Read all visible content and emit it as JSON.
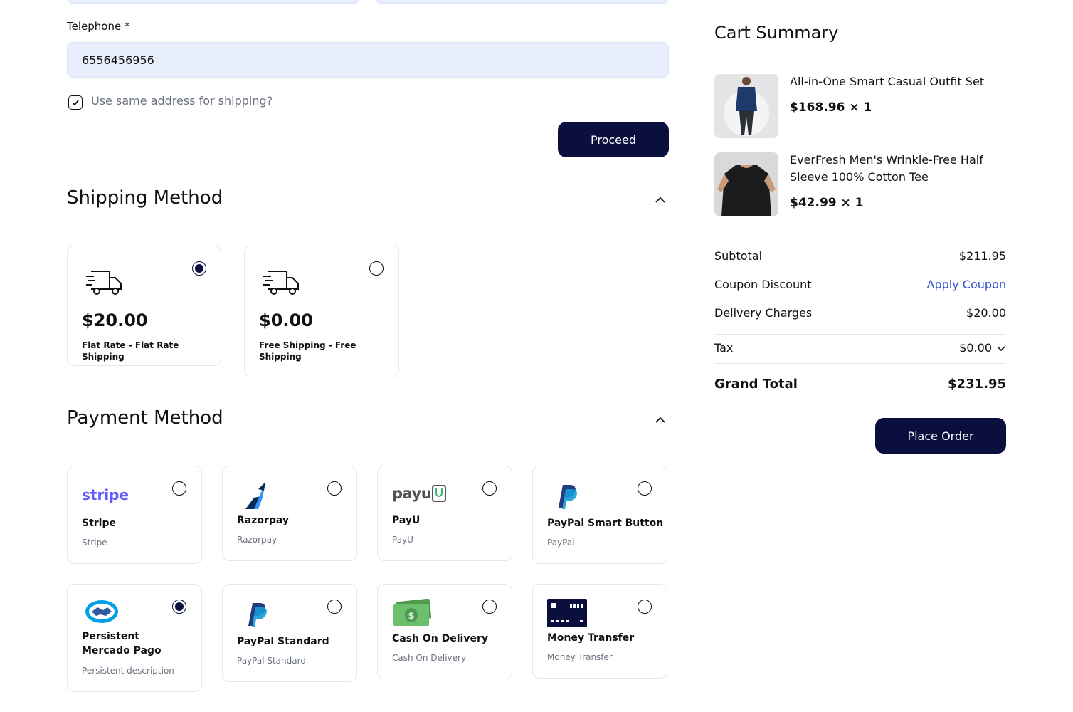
{
  "billing": {
    "telephone_label": "Telephone *",
    "telephone_value": "6556456956",
    "same_address_label": "Use same address for shipping?",
    "same_address_checked": true,
    "proceed_label": "Proceed"
  },
  "shipping": {
    "title": "Shipping Method",
    "options": [
      {
        "price": "$20.00",
        "name": "Flat Rate - Flat Rate Shipping",
        "selected": true,
        "icon": "truck-icon"
      },
      {
        "price": "$0.00",
        "name": "Free Shipping - Free Shipping",
        "selected": false,
        "icon": "truck-icon"
      }
    ]
  },
  "payment": {
    "title": "Payment Method",
    "options": [
      {
        "name": "Stripe",
        "sub": "Stripe",
        "logo": "stripe",
        "selected": false,
        "icon": "stripe-logo-icon"
      },
      {
        "name": "Razorpay",
        "sub": "Razorpay",
        "selected": false,
        "icon": "razorpay-logo-icon"
      },
      {
        "name": "PayU",
        "sub": "PayU",
        "logo": "payu",
        "selected": false,
        "icon": "payu-logo-icon"
      },
      {
        "name": "PayPal Smart Button",
        "sub": "PayPal",
        "selected": false,
        "icon": "paypal-logo-icon"
      },
      {
        "name": "Persistent Mercado Pago",
        "sub": "Persistent description",
        "selected": true,
        "icon": "mercado-pago-handshake-icon"
      },
      {
        "name": "PayPal Standard",
        "sub": "PayPal Standard",
        "selected": false,
        "icon": "paypal-logo-icon"
      },
      {
        "name": "Cash On Delivery",
        "sub": "Cash On Delivery",
        "selected": false,
        "icon": "cash-icon"
      },
      {
        "name": "Money Transfer",
        "sub": "Money Transfer",
        "selected": false,
        "icon": "card-transfer-icon"
      }
    ]
  },
  "cart": {
    "title": "Cart Summary",
    "items": [
      {
        "name": "All-in-One Smart Casual Outfit Set",
        "price_qty": "$168.96 × 1",
        "image": "man-casual-outfit-photo"
      },
      {
        "name": "EverFresh Men's Wrinkle-Free Half Sleeve 100% Cotton Tee",
        "price_qty": "$42.99 × 1",
        "image": "man-black-tee-photo"
      }
    ],
    "subtotal_label": "Subtotal",
    "subtotal_value": "$211.95",
    "coupon_label": "Coupon Discount",
    "coupon_action": "Apply Coupon",
    "delivery_label": "Delivery Charges",
    "delivery_value": "$20.00",
    "tax_label": "Tax",
    "tax_value": "$0.00",
    "grand_label": "Grand Total",
    "grand_value": "$231.95",
    "place_order_label": "Place Order"
  },
  "colors": {
    "primary": "#0a0f3d",
    "input_bg": "#e9eefc",
    "link": "#2c4fd6",
    "stripe": "#635bff"
  }
}
